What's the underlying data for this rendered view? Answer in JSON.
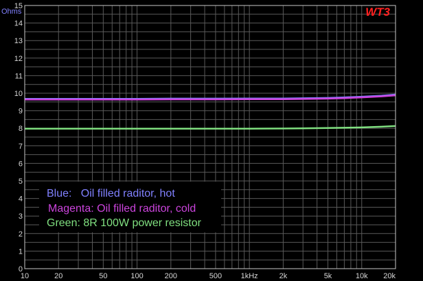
{
  "chart_data": {
    "type": "line",
    "x_scale": "log",
    "xlim": [
      10,
      20000
    ],
    "ylim": [
      0,
      15
    ],
    "grid": true,
    "y_unit_label": "Ohms",
    "badge": "WT3",
    "x_ticks": [
      {
        "value": 10,
        "label": "10"
      },
      {
        "value": 20,
        "label": "20"
      },
      {
        "value": 50,
        "label": "50"
      },
      {
        "value": 100,
        "label": "100"
      },
      {
        "value": 200,
        "label": "200"
      },
      {
        "value": 500,
        "label": "500"
      },
      {
        "value": 1000,
        "label": "1kHz"
      },
      {
        "value": 2000,
        "label": "2k"
      },
      {
        "value": 5000,
        "label": "5k"
      },
      {
        "value": 10000,
        "label": "10k"
      },
      {
        "value": 20000,
        "label": "20k"
      }
    ],
    "y_ticks": [
      0,
      1,
      2,
      3,
      4,
      5,
      6,
      7,
      8,
      9,
      10,
      11,
      12,
      13,
      14,
      15
    ],
    "legend": [
      {
        "label": "Blue:   Oil filled raditor, hot",
        "color": "#8080ff"
      },
      {
        "label": "Magenta: Oil filled raditor, cold",
        "color": "#cc44dd"
      },
      {
        "label": "Green: 8R 100W power resistor",
        "color": "#80e080"
      }
    ],
    "series": [
      {
        "color": "#8080ff",
        "x": [
          10,
          20,
          50,
          100,
          200,
          500,
          1000,
          2000,
          3000,
          5000,
          7000,
          10000,
          15000,
          20000
        ],
        "y": [
          9.68,
          9.68,
          9.68,
          9.68,
          9.69,
          9.69,
          9.7,
          9.7,
          9.71,
          9.73,
          9.76,
          9.8,
          9.86,
          9.92
        ]
      },
      {
        "color": "#cc44dd",
        "x": [
          10,
          20,
          50,
          100,
          200,
          500,
          1000,
          2000,
          3000,
          5000,
          7000,
          10000,
          15000,
          20000
        ],
        "y": [
          9.64,
          9.64,
          9.64,
          9.64,
          9.65,
          9.65,
          9.66,
          9.66,
          9.67,
          9.69,
          9.72,
          9.76,
          9.82,
          9.88
        ]
      },
      {
        "color": "#80e080",
        "x": [
          10,
          20,
          50,
          100,
          200,
          500,
          1000,
          2000,
          3000,
          5000,
          10000,
          15000,
          20000
        ],
        "y": [
          7.98,
          7.98,
          7.98,
          7.98,
          7.98,
          7.98,
          7.98,
          7.99,
          8.0,
          8.02,
          8.05,
          8.09,
          8.13
        ]
      }
    ]
  }
}
